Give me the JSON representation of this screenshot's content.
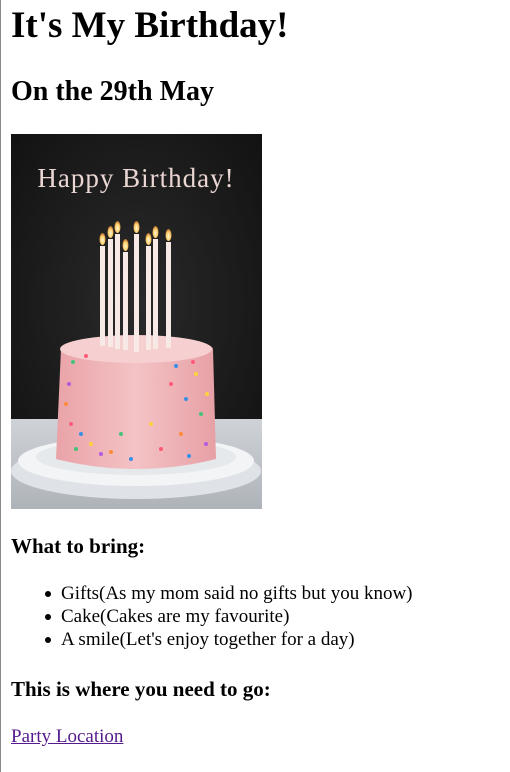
{
  "page": {
    "title": "It's My Birthday!",
    "subtitle": "On the 29th May"
  },
  "image": {
    "banner_text": "Happy Birthday!",
    "colors": {
      "background": "#1c1c1c",
      "cake": "#f1b7ba",
      "plate": "#e8ebee",
      "candle": "#f7e9e6",
      "flame": "#ffcf6a"
    }
  },
  "bring": {
    "heading": "What to bring:",
    "items": [
      "Gifts(As my mom said no gifts but you know)",
      "Cake(Cakes are my favourite)",
      "A smile(Let's enjoy together for a day)"
    ]
  },
  "location": {
    "heading": "This is where you need to go:",
    "link_text": "Party Location",
    "link_color": "#551a8b"
  }
}
